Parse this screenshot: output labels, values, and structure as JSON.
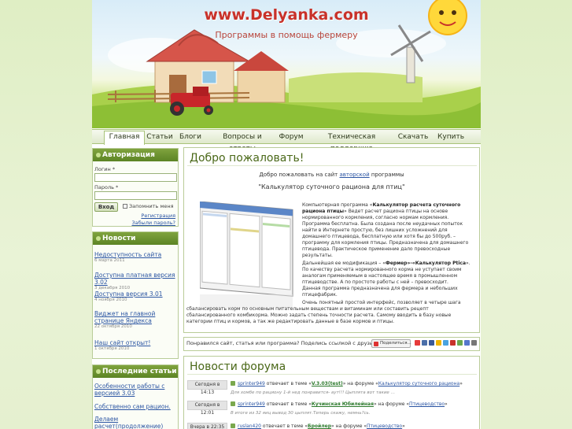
{
  "header": {
    "site_title": "www.Delyanka.com",
    "site_subtitle": "Программы в помощь фермеру"
  },
  "nav": {
    "items": [
      {
        "label": "Главная",
        "active": true
      },
      {
        "label": "Статьи"
      },
      {
        "label": "Блоги"
      },
      {
        "label": "Вопросы и ответы"
      },
      {
        "label": "Форум"
      },
      {
        "label": "Техническая поддержка"
      },
      {
        "label": "Скачать"
      },
      {
        "label": "Купить"
      }
    ]
  },
  "auth": {
    "title": "Авторизация",
    "login_label": "Логин *",
    "password_label": "Пароль *",
    "login_value": "",
    "password_value": "",
    "submit_label": "Вход",
    "remember_label": "Запомнить меня",
    "register_link": "Регистрация",
    "forgot_link": "Забыли пароль?"
  },
  "news": {
    "title": "Новости",
    "items": [
      {
        "title": "Недоступность сайта",
        "date": "6 марта 2011"
      },
      {
        "title": "Доступна платная версия 3.02",
        "date": "3 декабря 2010"
      },
      {
        "title": "Доступна версия 3.01",
        "date": "4 ноября 2010"
      },
      {
        "title": "Виджет на главной странице Яндекса",
        "date": "22 октября 2010"
      },
      {
        "title": "Наш сайт открыт!",
        "date": "1 октября 2010"
      }
    ]
  },
  "latest_articles": {
    "title": "Последние статьи",
    "items": [
      {
        "title": "Особенности работы с версией 3.03"
      },
      {
        "title": "Собственно сам рацион."
      },
      {
        "title": "Делаем расчет(продолжение)"
      }
    ]
  },
  "welcome": {
    "title": "Добро пожаловать!",
    "intro_before": "Добро пожаловать на сайт ",
    "intro_link": "авторской",
    "intro_after": " программы",
    "program_name": "\"Калькулятор суточного рациона для птиц\"",
    "p1_prefix": "Компьютерная программа «",
    "p1_bold": "Калькулятор расчета суточного рациона птицы",
    "p1_rest": "» Ведет расчет рациона птицы на основе нормированного кормления, согласно нормам кормления. Программа бесплатна. Была создана после неудачных попыток найти в Интернете простую, без лишних усложнений для домашнего птицевода, бесплатную или хотя бы до 500руб. – программу для кормления птицы. Предназначена для домашнего птицевода. Практическое применение дало превосходные результаты.",
    "p2_prefix": "Дальнейшая ее модификация – «",
    "p2_bold": "Фермер»-«Калькулятор Ptica",
    "p2_rest": "». По качеству расчета нормированного корма не уступает своим аналогам применяемым в настоящее время в промышленном птицеводстве. А по простоте работы с ней – превосходит.",
    "p2_extra": "Данная программа предназначена для фермера и небольших птицефабрик.",
    "p3": "Очень понятный простой интерфейс, позволяет в четыре шага сбалансировать корм по основным питательным веществам и витаминам или составить рецепт сбалансированного комбикорма. Можно задать степень точности расчета. Самому вводить в базу новые категории птиц и кормов, а так же редактировать данные в базе кормов и птицы."
  },
  "share": {
    "text": "Понравился сайт, статья или программа? Поделись ссылкой с друзьями...",
    "button_label": "Поделиться..."
  },
  "forum_news": {
    "title": "Новости форума",
    "rows": [
      {
        "date": "Сегодня в 14:13",
        "user": "sprinter949",
        "mid": " отвечает в теме «",
        "topic": "V.3.03(test)",
        "mid2": "» на форуме «",
        "forum": "Калькулятор суточного рациона",
        "end": "»",
        "quote": "Для хомбе по рациону 1-й нед понравится- аут!!! Цыплята вот такие …"
      },
      {
        "date": "Сегодня в 12:01",
        "user": "sprinter949",
        "mid": " отвечает в теме «",
        "topic": "Кучинская Юбилейная",
        "mid2": "» на форуме «",
        "forum": "Птицеводство",
        "end": "»",
        "quote": "В итоге из 32 яиц вывод 30 цыплят.Теперь скажу, немнь?сь."
      },
      {
        "date": "Вчера в 22:35",
        "user": "ruslan420",
        "mid": " отвечает в теме «",
        "topic": "Бройлер",
        "mid2": "» на форуме «",
        "forum": "Птицеводство",
        "end": "»",
        "quote": ""
      }
    ]
  }
}
